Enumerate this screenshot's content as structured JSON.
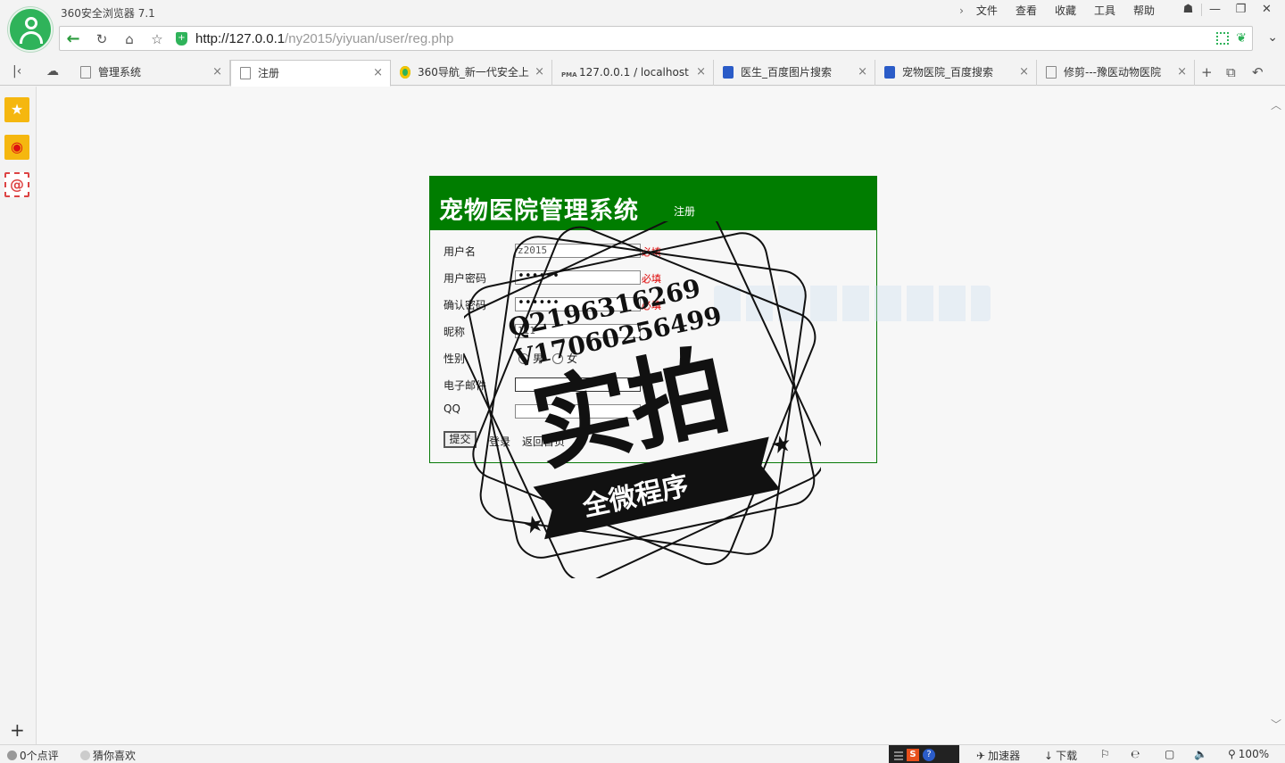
{
  "browser": {
    "title": "360安全浏览器 7.1",
    "menu": [
      "文件",
      "查看",
      "收藏",
      "工具",
      "帮助"
    ],
    "url_host": "http://127.0.0.1",
    "url_path": "/ny2015/yiyuan/user/reg.php"
  },
  "tabs": [
    {
      "label": "管理系统",
      "icon": "page-icon",
      "active": false
    },
    {
      "label": "注册",
      "icon": "page-icon",
      "active": true
    },
    {
      "label": "360导航_新一代安全上",
      "icon": "360-icon",
      "active": false
    },
    {
      "label": "127.0.0.1 / localhost",
      "icon": "pma-icon",
      "active": false
    },
    {
      "label": "医生_百度图片搜索",
      "icon": "baidu-icon",
      "active": false
    },
    {
      "label": "宠物医院_百度搜索",
      "icon": "baidu-icon",
      "active": false
    },
    {
      "label": "修剪---豫医动物医院",
      "icon": "page-icon",
      "active": false
    }
  ],
  "form": {
    "title": "宠物医院管理系统",
    "subtitle": "注册",
    "username_label": "用户名",
    "username_value": "z2015",
    "password_label": "用户密码",
    "password_value": "••••••",
    "confirm_label": "确认密码",
    "confirm_value": "••••••",
    "nickname_label": "昵称",
    "nickname_value": "111",
    "gender_label": "性别",
    "gender_male": "男",
    "gender_female": "女",
    "email_label": "电子邮件",
    "email_value": "",
    "qq_label": "QQ",
    "qq_value": "",
    "required_text": "必填",
    "submit_label": "提交",
    "login_link": "登录",
    "home_link": "返回首页"
  },
  "watermark": {
    "line1": "Q2196316269",
    "line2": "V17060256499",
    "big": "实拍",
    "banner": "全微程序"
  },
  "status": {
    "comments": "0个点评",
    "guess": "猜你喜欢",
    "accelerator": "加速器",
    "download": "下载",
    "zoom": "100%",
    "ime_label": "S"
  },
  "colors": {
    "header_green": "#007d00",
    "brand_green": "#2fb35a",
    "required_red": "#dd0000"
  }
}
